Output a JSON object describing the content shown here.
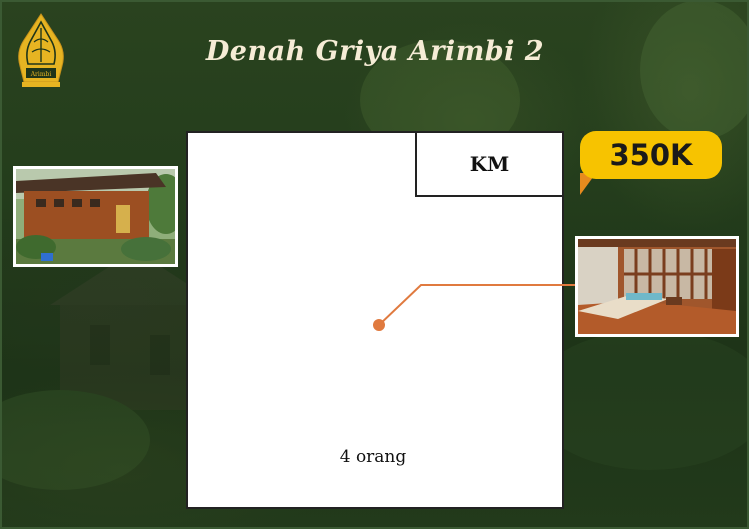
{
  "title": "Denah Griya Arimbi 2",
  "logo": {
    "icon": "gunungan-logo-icon",
    "alt_text": "Arimbi"
  },
  "floor_plan": {
    "bathroom_label": "KM",
    "occupancy_label": "4 orang"
  },
  "price": {
    "label": "350K"
  },
  "photos": {
    "exterior": {
      "icon": "wooden-house-photo"
    },
    "interior": {
      "icon": "bedroom-interior-photo"
    }
  },
  "colors": {
    "background": "#243d1c",
    "title": "#f6ecd6",
    "accent_orange": "#e07a3f",
    "price_badge": "#f7c300",
    "logo_gold": "#e6b422"
  }
}
